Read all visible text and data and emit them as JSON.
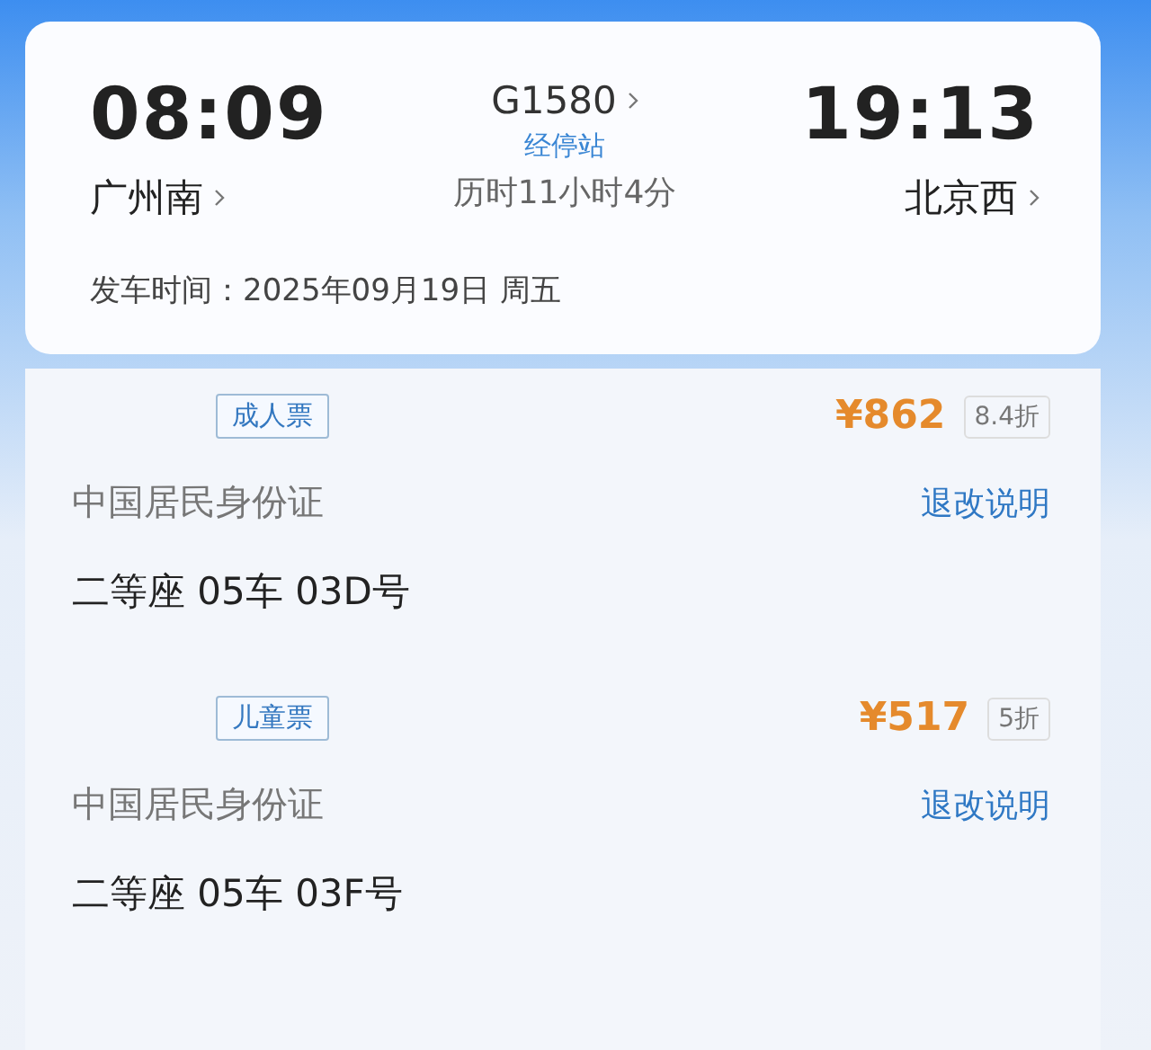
{
  "trip": {
    "departure_time": "08:09",
    "departure_station": "广州南",
    "train_number": "G1580",
    "stops_link": "经停站",
    "duration": "历时11小时4分",
    "arrival_time": "19:13",
    "arrival_station": "北京西",
    "departure_date_label": "发车时间：",
    "departure_date": "2025年09月19日 周五"
  },
  "passengers": [
    {
      "ticket_type": "成人票",
      "price": "¥862",
      "discount": "8.4折",
      "id_type": "中国居民身份证",
      "refund_link": "退改说明",
      "seat": "二等座 05车 03D号"
    },
    {
      "ticket_type": "儿童票",
      "price": "¥517",
      "discount": "5折",
      "id_type": "中国居民身份证",
      "refund_link": "退改说明",
      "seat": "二等座 05车 03F号"
    }
  ]
}
